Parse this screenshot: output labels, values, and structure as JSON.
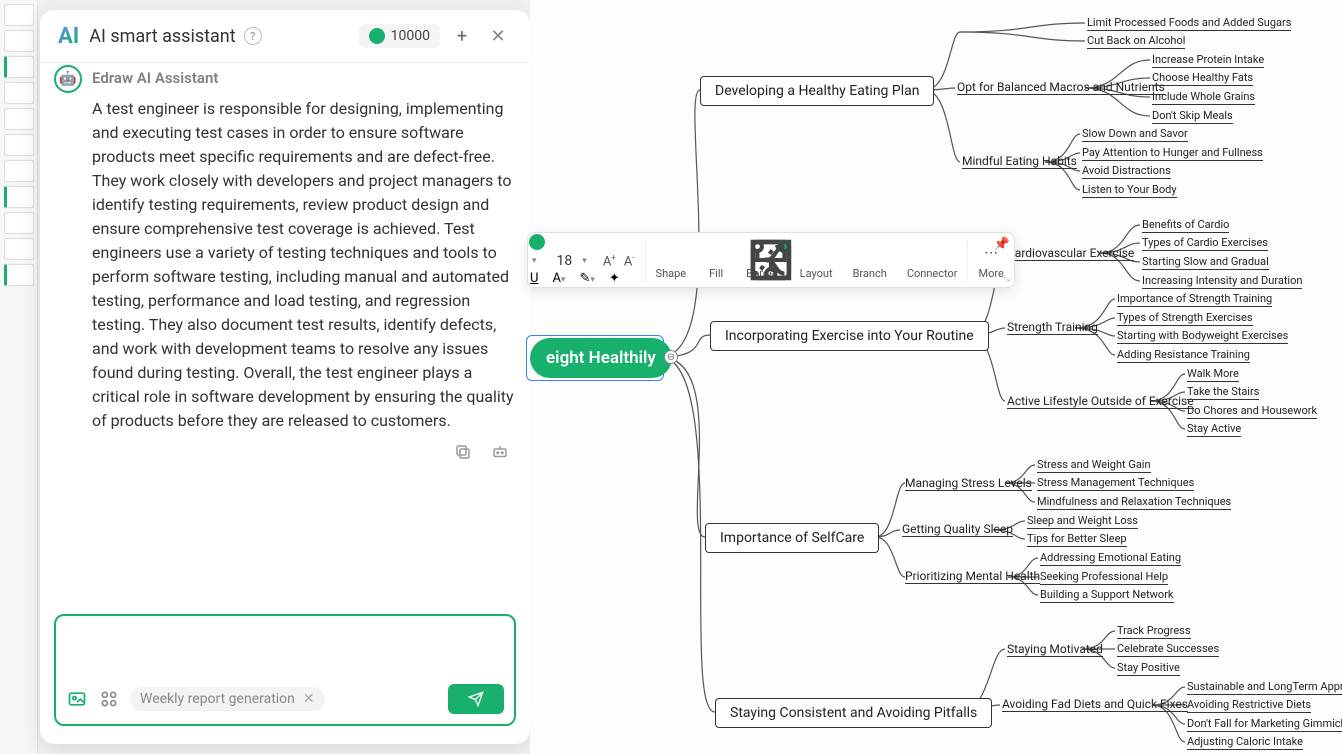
{
  "header": {
    "logo": "AI",
    "title": "AI smart assistant",
    "credits": "10000"
  },
  "chat": {
    "sender": "Edraw AI Assistant",
    "message": "A test engineer is responsible for designing, implementing and executing test cases in order to ensure software products meet specific requirements and are defect-free. They work closely with developers and project managers to identify testing requirements, review product design and ensure comprehensive test coverage is achieved. Test engineers use a variety of testing techniques and tools to perform software testing, including manual and automated testing, performance and load testing, and regression testing. They also document test results, identify defects, and work with development teams to resolve any issues found during testing. Overall, the test engineer plays a critical role in software development by ensuring the quality of products before they are released to customers."
  },
  "input": {
    "chip": "Weekly report generation"
  },
  "toolbar": {
    "font_size": "18",
    "shape": "Shape",
    "fill": "Fill",
    "border": "Border",
    "layout": "Layout",
    "branch": "Branch",
    "connector": "Connector",
    "more": "More",
    "underline": "U",
    "a_inc": "A",
    "a_dec": "A"
  },
  "mindmap": {
    "central": "eight Healthily",
    "branches": [
      {
        "title": "Developing a Healthy Eating Plan",
        "subs": [
          {
            "title": "",
            "leaves": [
              "Limit Processed Foods and Added Sugars",
              "Cut Back on Alcohol"
            ]
          },
          {
            "title": "Opt for Balanced Macros and Nutrients",
            "leaves": [
              "Increase Protein Intake",
              "Choose Healthy Fats",
              "Include Whole Grains",
              "Don't Skip Meals"
            ]
          },
          {
            "title": "Mindful Eating Habits",
            "leaves": [
              "Slow Down and Savor",
              "Pay Attention to Hunger and Fullness",
              "Avoid Distractions",
              "Listen to Your Body"
            ]
          }
        ]
      },
      {
        "title": "Incorporating Exercise into Your Routine",
        "subs": [
          {
            "title": "Cardiovascular Exercise",
            "leaves": [
              "Benefits of Cardio",
              "Types of Cardio Exercises",
              "Starting Slow and Gradual",
              "Increasing Intensity and Duration"
            ]
          },
          {
            "title": "Strength Training",
            "leaves": [
              "Importance of Strength Training",
              "Types of Strength Exercises",
              "Starting with Bodyweight Exercises",
              "Adding Resistance Training"
            ]
          },
          {
            "title": "Active Lifestyle Outside of Exercise",
            "leaves": [
              "Walk More",
              "Take the Stairs",
              "Do Chores and Housework",
              "Stay Active"
            ]
          }
        ]
      },
      {
        "title": "Importance of SelfCare",
        "subs": [
          {
            "title": "Managing Stress Levels",
            "leaves": [
              "Stress and Weight Gain",
              "Stress Management Techniques",
              "Mindfulness and Relaxation Techniques"
            ]
          },
          {
            "title": "Getting Quality Sleep",
            "leaves": [
              "Sleep and Weight Loss",
              "Tips for Better Sleep"
            ]
          },
          {
            "title": "Prioritizing Mental Health",
            "leaves": [
              "Addressing Emotional Eating",
              "Seeking Professional Help",
              "Building a Support Network"
            ]
          }
        ]
      },
      {
        "title": "Staying Consistent and Avoiding Pitfalls",
        "subs": [
          {
            "title": "Staying Motivated",
            "leaves": [
              "Track Progress",
              "Celebrate Successes",
              "Stay Positive"
            ]
          },
          {
            "title": "Avoiding Fad Diets and Quick Fixes",
            "leaves": [
              "Sustainable and LongTerm Approaches",
              "Avoiding Restrictive Diets",
              "Don't Fall for Marketing Gimmicks",
              "Adjusting Caloric Intake"
            ]
          }
        ]
      }
    ]
  }
}
